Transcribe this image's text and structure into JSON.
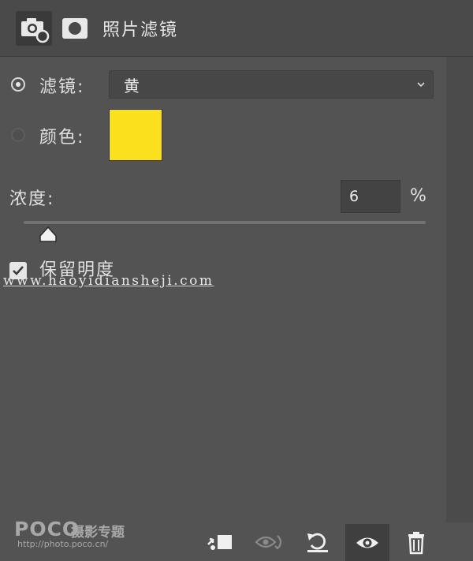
{
  "header": {
    "title": "照片滤镜",
    "icons": [
      "camera-adjustment-icon",
      "layer-mask-icon"
    ]
  },
  "filter": {
    "label": "滤镜:",
    "value": "黄",
    "selected": true
  },
  "color": {
    "label": "颜色:",
    "swatch": "#fbe11d",
    "selected": false
  },
  "density": {
    "label": "浓度:",
    "value": "6",
    "unit": "%",
    "slider_level": 0.06
  },
  "preserve": {
    "label": "保留明度",
    "checked": true
  },
  "watermark": {
    "text": "www.haoyidiansheji.com"
  },
  "footer": {
    "logo": "POCO",
    "logo_sub": "摄影专题",
    "url": "http://photo.poco.cn/",
    "icons": [
      "clip-to-layer-icon",
      "view-previous-state-icon",
      "reset-icon",
      "eye-icon",
      "trash-icon"
    ]
  },
  "colors": {
    "panel_bg": "#535353",
    "swatch_yellow": "#fbe11d"
  }
}
